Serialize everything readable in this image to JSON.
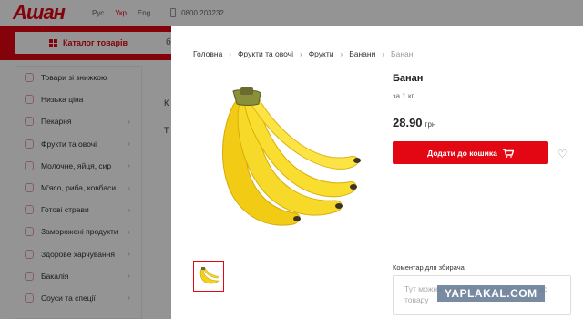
{
  "header": {
    "logo": "Ашан",
    "languages": [
      "Рус",
      "Укр",
      "Eng"
    ],
    "active_language": "Укр",
    "phone": "0800 203232"
  },
  "nav": {
    "catalog_label": "Каталог товарів",
    "search_stub": "б"
  },
  "sidebar": {
    "items": [
      {
        "label": "Товари зі знижкою"
      },
      {
        "label": "Низька ціна"
      },
      {
        "label": "Пекарня"
      },
      {
        "label": "Фрукти та овочі"
      },
      {
        "label": "Молочне, яйця, сир"
      },
      {
        "label": "М'ясо, риба, ковбаси"
      },
      {
        "label": "Готові страви"
      },
      {
        "label": "Заморожені продукти"
      },
      {
        "label": "Здорове харчування"
      },
      {
        "label": "Бакалія"
      },
      {
        "label": "Соуси та спеції"
      }
    ]
  },
  "background": {
    "text_1": "К",
    "text_2": "Т"
  },
  "modal": {
    "breadcrumb": [
      "Головна",
      "Фрукти та овочі",
      "Фрукти",
      "Банани",
      "Банан"
    ],
    "title": "Банан",
    "unit": "за 1 кг",
    "price": "28.90",
    "currency": "грн",
    "add_to_cart": "Додати до кошика",
    "comment_label": "Коментар для збирача",
    "comment_placeholder": "Тут можна написати ваші побажання до товару"
  },
  "watermark": "YAPLAKAL.COM",
  "colors": {
    "accent": "#e30613",
    "banana": "#f5d21a"
  }
}
